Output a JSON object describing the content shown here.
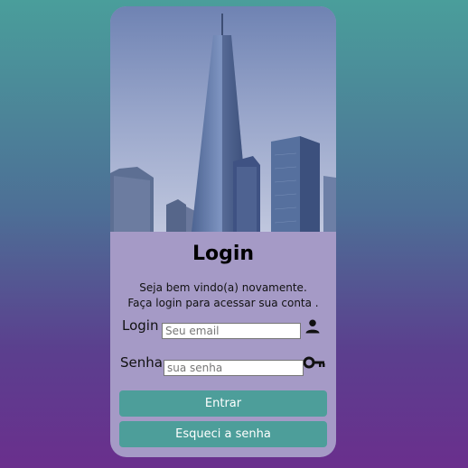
{
  "login": {
    "title": "Login",
    "subtitle": "Seja bem vindo(a) novamente. Faça login para acessar sua conta .",
    "email_label": "Login",
    "email_placeholder": "Seu email",
    "password_label": "Senha",
    "password_placeholder": "sua senha",
    "submit_label": "Entrar",
    "forgot_label": "Esqueci a senha"
  },
  "icons": {
    "user": "person-icon",
    "password": "key-icon"
  },
  "colors": {
    "button": "#4d9e9a",
    "card": "#a59ac6",
    "bg_top": "#4a9e9b",
    "bg_bottom": "#6a2f8d"
  }
}
